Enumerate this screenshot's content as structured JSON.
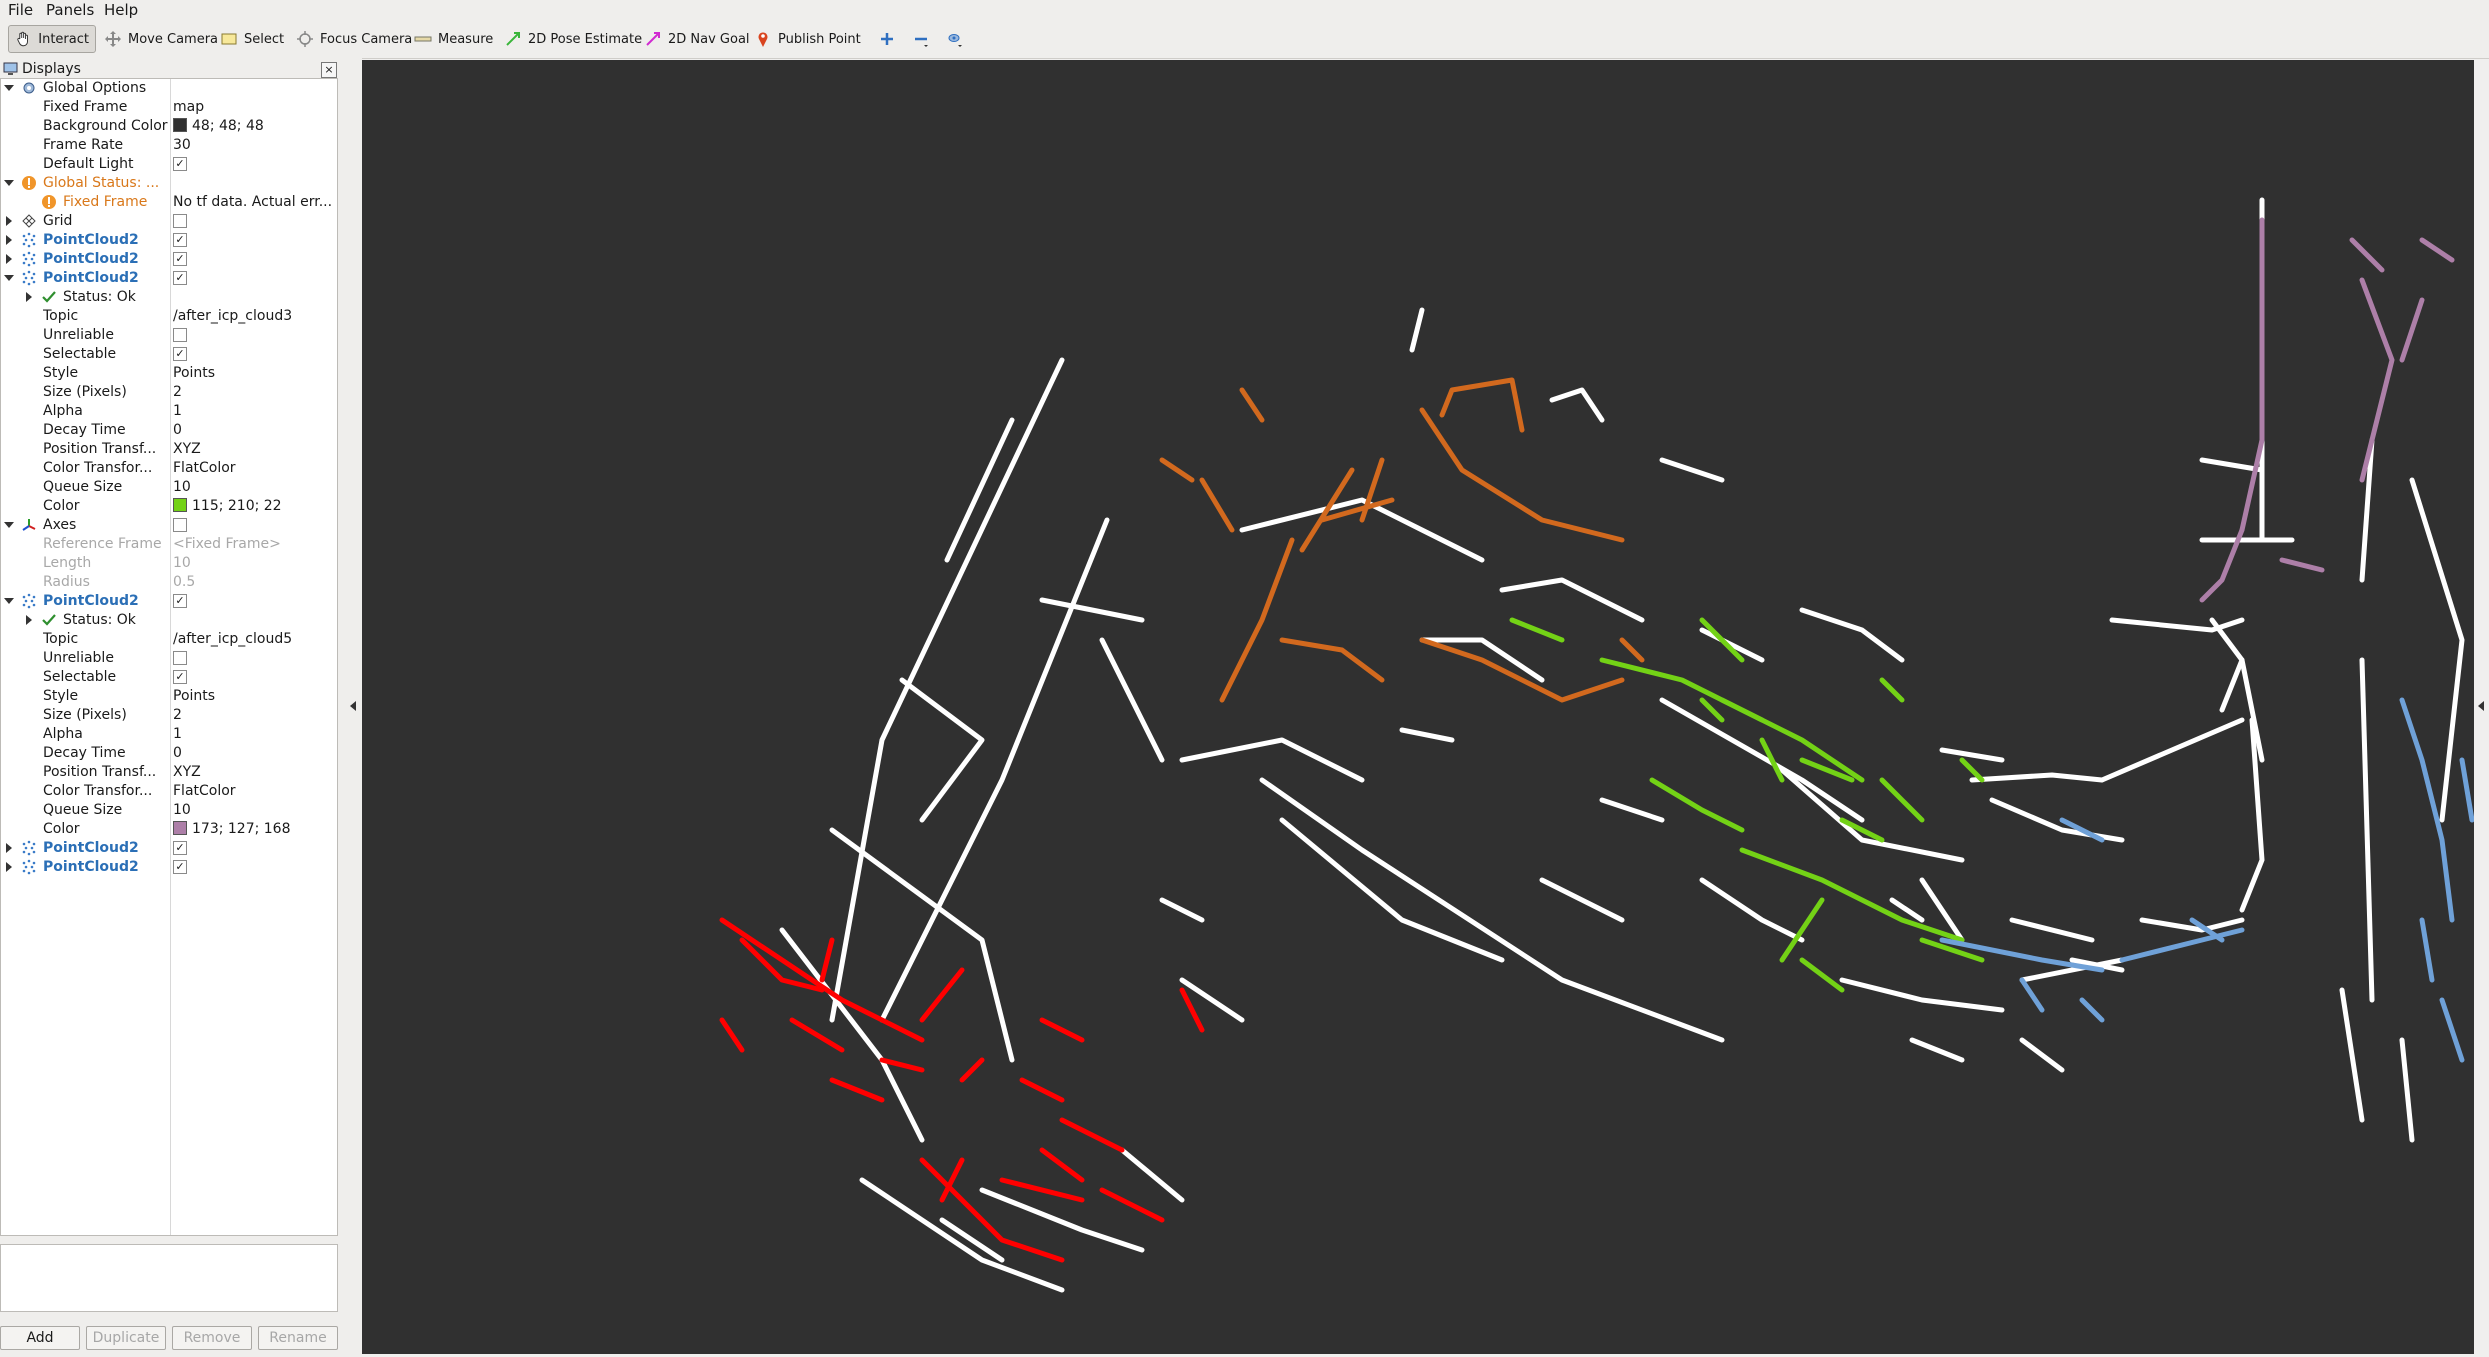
{
  "menubar": {
    "file": "File",
    "panels": "Panels",
    "help": "Help"
  },
  "toolbar": {
    "interact": "Interact",
    "move_camera": "Move Camera",
    "select": "Select",
    "focus_camera": "Focus Camera",
    "measure": "Measure",
    "pose_estimate": "2D Pose Estimate",
    "nav_goal": "2D Nav Goal",
    "publish_point": "Publish Point"
  },
  "displays_panel": {
    "title": "Displays",
    "close": "×",
    "rows": {
      "global_options": "Global Options",
      "fixed_frame_label": "Fixed Frame",
      "fixed_frame_value": "map",
      "bg_color_label": "Background Color",
      "bg_color_value": "48; 48; 48",
      "frame_rate_label": "Frame Rate",
      "frame_rate_value": "30",
      "default_light_label": "Default Light",
      "global_status": "Global Status: ...",
      "fixed_frame_err_label": "Fixed Frame",
      "fixed_frame_err_value": "No tf data.  Actual err...",
      "grid": "Grid",
      "pc1": "PointCloud2",
      "pc2": "PointCloud2",
      "pc3": "PointCloud2",
      "status_ok_1": "Status: Ok",
      "topic_label": "Topic",
      "topic1": "/after_icp_cloud3",
      "unreliable": "Unreliable",
      "selectable": "Selectable",
      "style": "Style",
      "style_value": "Points",
      "size": "Size (Pixels)",
      "size_value": "2",
      "alpha": "Alpha",
      "alpha_value": "1",
      "decay": "Decay Time",
      "decay_value": "0",
      "pos_transf": "Position Transf...",
      "pos_transf_value": "XYZ",
      "color_transf": "Color Transfor...",
      "color_transf_value": "FlatColor",
      "queue": "Queue Size",
      "queue_value": "10",
      "color": "Color",
      "color1_value": "115; 210; 22",
      "axes": "Axes",
      "ref_frame": "Reference Frame",
      "ref_frame_value": "<Fixed Frame>",
      "length": "Length",
      "length_value": "10",
      "radius": "Radius",
      "radius_value": "0.5",
      "pc4": "PointCloud2",
      "status_ok_2": "Status: Ok",
      "topic2": "/after_icp_cloud5",
      "color2_value": "173; 127; 168",
      "pc5": "PointCloud2",
      "pc6": "PointCloud2",
      "check": "✓"
    },
    "buttons": {
      "add": "Add",
      "duplicate": "Duplicate",
      "remove": "Remove",
      "rename": "Rename"
    }
  },
  "colors": {
    "background": "#303030",
    "green_cloud": "#73d216",
    "purple_cloud": "#ad7fa8",
    "orange_cloud": "#d2691e",
    "red_cloud": "#ff0000",
    "blue_cloud": "#6fa1d8",
    "white_cloud": "#ffffff"
  }
}
